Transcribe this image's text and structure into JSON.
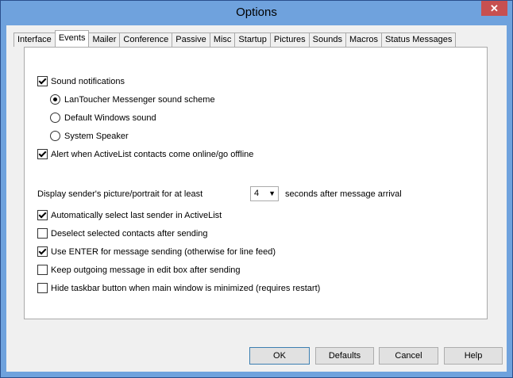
{
  "window": {
    "title": "Options",
    "close_glyph": "✕"
  },
  "tabs": [
    {
      "label": "Interface"
    },
    {
      "label": "Events",
      "active": true
    },
    {
      "label": "Mailer"
    },
    {
      "label": "Conference"
    },
    {
      "label": "Passive"
    },
    {
      "label": "Misc"
    },
    {
      "label": "Startup"
    },
    {
      "label": "Pictures"
    },
    {
      "label": "Sounds"
    },
    {
      "label": "Macros"
    },
    {
      "label": "Status Messages"
    }
  ],
  "events": {
    "sound_notifications": {
      "label": "Sound notifications",
      "checked": true
    },
    "sound_scheme": {
      "lantoucher": {
        "label": "LanToucher Messenger sound scheme",
        "selected": true
      },
      "default_windows": {
        "label": "Default Windows sound",
        "selected": false
      },
      "system_speaker": {
        "label": "System Speaker",
        "selected": false
      }
    },
    "alert_online": {
      "label": "Alert when ActiveList contacts come online/go offline",
      "checked": true
    },
    "display_picture": {
      "label_before": "Display sender's picture/portrait for at least",
      "value": "4",
      "label_after": "seconds after message arrival"
    },
    "auto_select_sender": {
      "label": "Automatically select last sender in ActiveList",
      "checked": true
    },
    "deselect_contacts": {
      "label": "Deselect selected contacts after sending",
      "checked": false
    },
    "use_enter": {
      "label": "Use ENTER for message sending (otherwise for line feed)",
      "checked": true
    },
    "keep_outgoing": {
      "label": "Keep outgoing message in edit box after sending",
      "checked": false
    },
    "hide_taskbar": {
      "label": "Hide taskbar button when main window is minimized (requires restart)",
      "checked": false
    }
  },
  "buttons": {
    "ok": "OK",
    "defaults": "Defaults",
    "cancel": "Cancel",
    "help": "Help"
  }
}
